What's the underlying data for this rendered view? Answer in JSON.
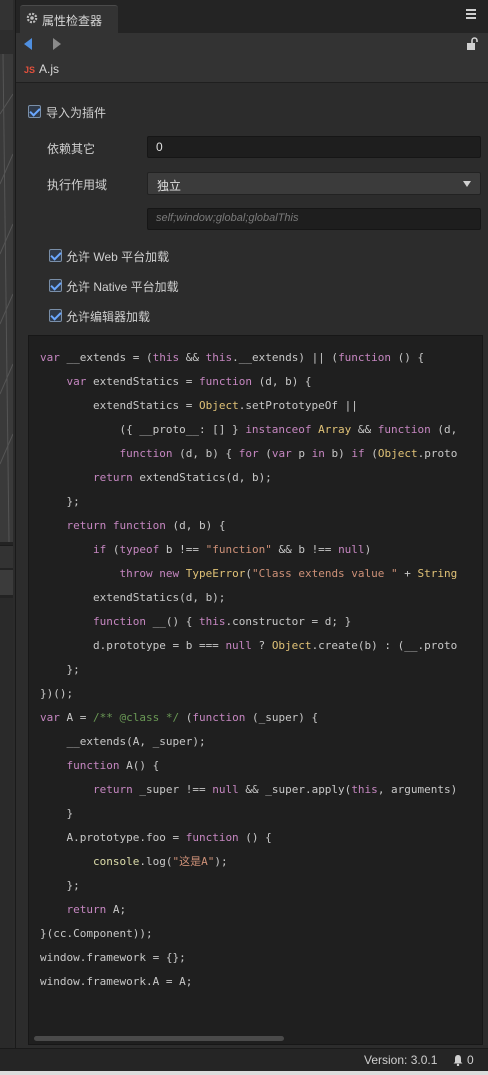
{
  "tab": {
    "title": "属性检查器",
    "gear_icon": "gear-icon",
    "menu_icon": "menu-icon"
  },
  "nav": {
    "back_icon": "arrow-left-icon",
    "forward_icon": "arrow-right-icon",
    "lock_icon": "unlock-icon"
  },
  "file": {
    "badge": "JS",
    "name": "A.js"
  },
  "form": {
    "import_as_plugin": {
      "label": "导入为插件",
      "checked": true
    },
    "depends": {
      "label": "依赖其它",
      "value": "0"
    },
    "scope": {
      "label": "执行作用域",
      "value": "独立",
      "placeholder": "self;window;global;globalThis"
    },
    "allow_web": {
      "label": "允许 Web 平台加载",
      "checked": true
    },
    "allow_native": {
      "label": "允许 Native 平台加载",
      "checked": true
    },
    "allow_editor": {
      "label": "允许编辑器加载",
      "checked": true
    }
  },
  "colors": {
    "accent": "#4f8fe0",
    "keyword": "#c586c0",
    "function": "#dcdcaa",
    "type": "#e0c277",
    "string": "#ce9178",
    "comment": "#6a9955"
  },
  "code": [
    "var __extends = (this && this.__extends) || (function () {",
    "    var extendStatics = function (d, b) {",
    "        extendStatics = Object.setPrototypeOf ||",
    "            ({ __proto__: [] } instanceof Array && function (d,",
    "            function (d, b) { for (var p in b) if (Object.proto",
    "        return extendStatics(d, b);",
    "    };",
    "    return function (d, b) {",
    "        if (typeof b !== \"function\" && b !== null)",
    "            throw new TypeError(\"Class extends value \" + String",
    "        extendStatics(d, b);",
    "        function __() { this.constructor = d; }",
    "        d.prototype = b === null ? Object.create(b) : (__.proto",
    "    };",
    "})();",
    "var A = /** @class */ (function (_super) {",
    "    __extends(A, _super);",
    "    function A() {",
    "        return _super !== null && _super.apply(this, arguments)",
    "    }",
    "    A.prototype.foo = function () {",
    "        console.log(\"这是A\");",
    "    };",
    "    return A;",
    "}(cc.Component));",
    "window.framework = {};",
    "window.framework.A = A;"
  ],
  "status": {
    "version": "Version: 3.0.1",
    "notifications": "0",
    "bell_icon": "bell-icon"
  }
}
